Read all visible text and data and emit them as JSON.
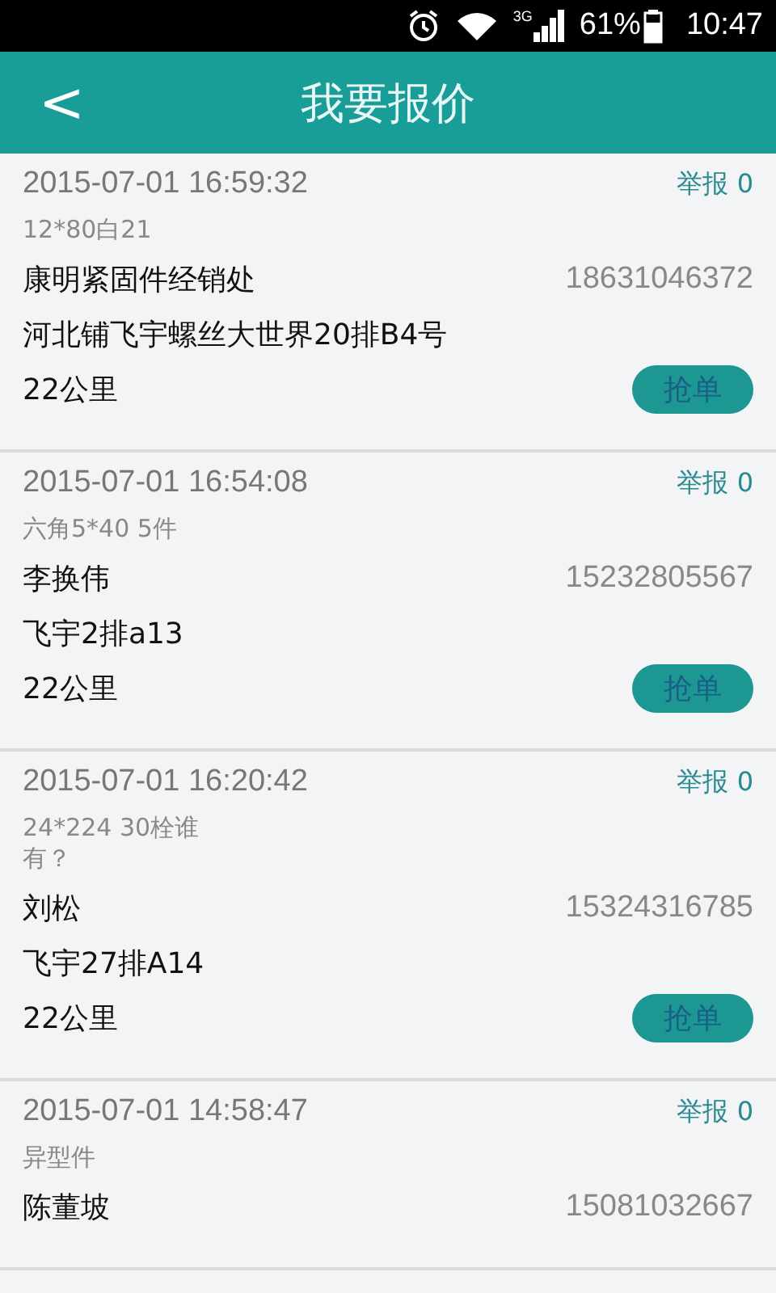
{
  "status_bar": {
    "network": "3G",
    "battery": "61%",
    "time": "10:47"
  },
  "header": {
    "back": "<",
    "title": "我要报价"
  },
  "quotes": [
    {
      "time": "2015-07-01 16:59:32",
      "report": "举报",
      "report_count": "0",
      "note": "12*80白21",
      "name": "康明紧固件经销处",
      "phone": "18631046372",
      "address": "河北铺飞宇螺丝大世界20排B4号",
      "distance": "22公里",
      "action": "抢单"
    },
    {
      "time": "2015-07-01 16:54:08",
      "report": "举报",
      "report_count": "0",
      "note": "六角5*40   5件",
      "name": "李换伟",
      "phone": "15232805567",
      "address": "飞宇2排a13",
      "distance": "22公里",
      "action": "抢单"
    },
    {
      "time": "2015-07-01 16:20:42",
      "report": "举报",
      "report_count": "0",
      "note": "24*224 30栓谁有？",
      "name": "刘松",
      "phone": "15324316785",
      "address": "飞宇27排A14",
      "distance": "22公里",
      "action": "抢单"
    },
    {
      "time": "2015-07-01 14:58:47",
      "report": "举报",
      "report_count": "0",
      "note": "异型件",
      "name": "陈董坡",
      "phone": "15081032667"
    }
  ]
}
